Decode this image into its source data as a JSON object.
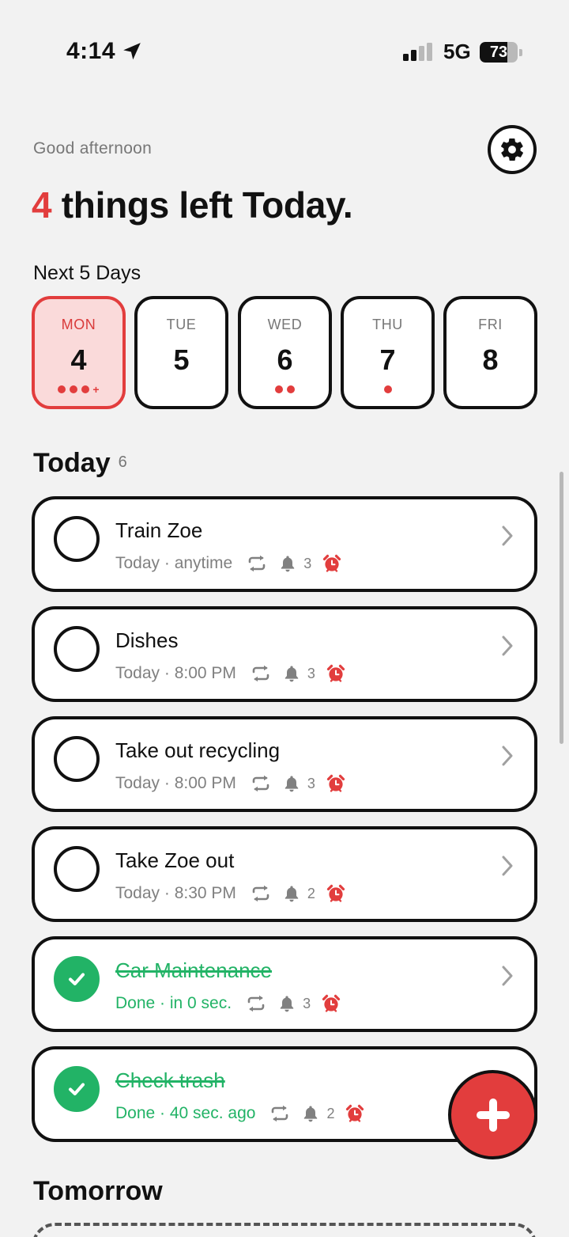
{
  "status_bar": {
    "time": "4:14",
    "network": "5G",
    "battery": "73",
    "battery_level": 0.73
  },
  "header": {
    "greeting": "Good afternoon",
    "settings_icon": "gear-icon",
    "headline_count": "4",
    "headline_text": " things left Today."
  },
  "next_days": {
    "label": "Next 5 Days",
    "days": [
      {
        "name": "MON",
        "num": "4",
        "dots": 3,
        "more": "+",
        "selected": true
      },
      {
        "name": "TUE",
        "num": "5",
        "dots": 0,
        "more": "",
        "selected": false
      },
      {
        "name": "WED",
        "num": "6",
        "dots": 2,
        "more": "",
        "selected": false
      },
      {
        "name": "THU",
        "num": "7",
        "dots": 1,
        "more": "",
        "selected": false
      },
      {
        "name": "FRI",
        "num": "8",
        "dots": 0,
        "more": "",
        "selected": false
      }
    ]
  },
  "today": {
    "title": "Today",
    "count": "6",
    "tasks": [
      {
        "title": "Train Zoe",
        "meta": "Today · anytime",
        "reminders": "3",
        "done": false
      },
      {
        "title": "Dishes",
        "meta": "Today · 8:00 PM",
        "reminders": "3",
        "done": false
      },
      {
        "title": "Take out recycling",
        "meta": "Today · 8:00 PM",
        "reminders": "3",
        "done": false
      },
      {
        "title": "Take Zoe out",
        "meta": "Today · 8:30 PM",
        "reminders": "2",
        "done": false
      },
      {
        "title": "Car Maintenance",
        "meta": "Done · in 0 sec.",
        "reminders": "3",
        "done": true
      },
      {
        "title": "Check trash",
        "meta": "Done · 40 sec. ago",
        "reminders": "2",
        "done": true
      }
    ]
  },
  "tomorrow": {
    "title": "Tomorrow"
  },
  "colors": {
    "accent": "#e23d3d",
    "done": "#22b366",
    "selected_bg": "#fadada"
  }
}
